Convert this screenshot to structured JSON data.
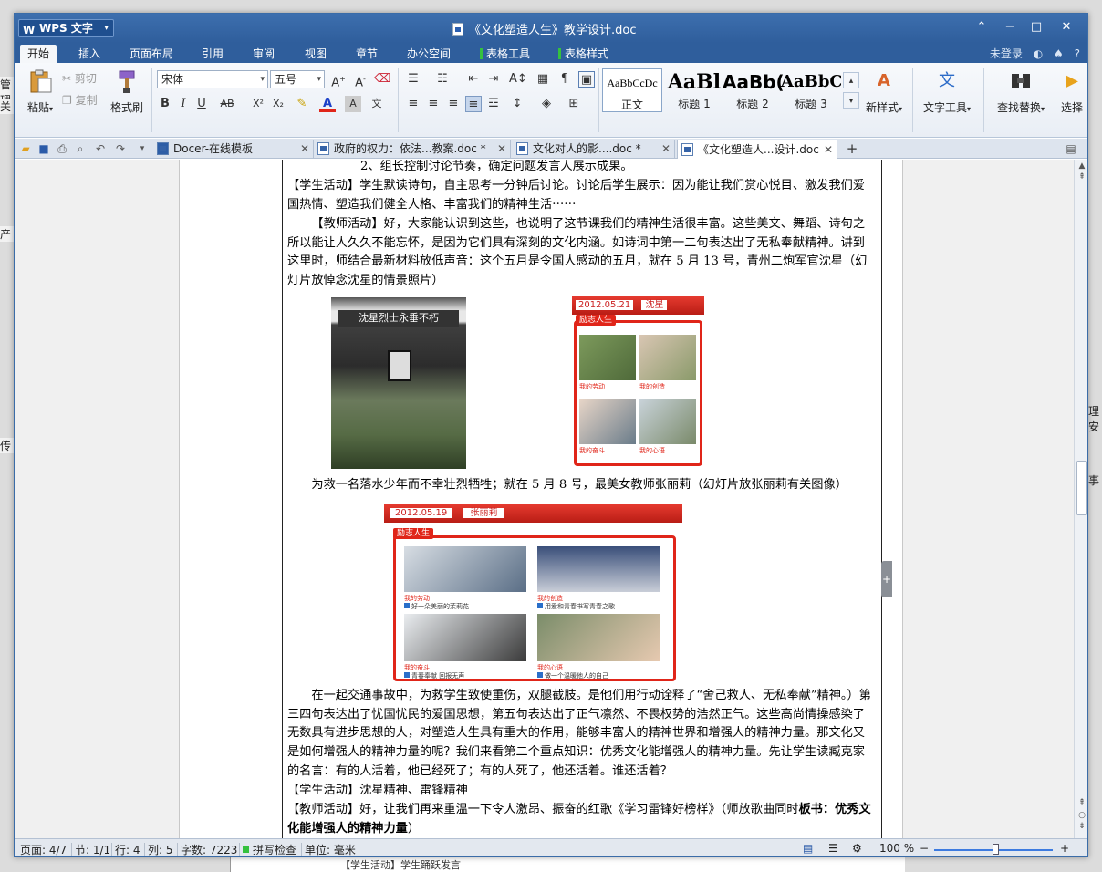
{
  "background": {
    "left_labels": [
      "管理",
      "关",
      "产",
      "传"
    ],
    "right_labels": [
      "理安",
      "事"
    ],
    "bottom_text": "【学生活动】学生踊跃发言"
  },
  "titlebar": {
    "app_name": "WPS 文字",
    "doc_title": "《文化塑造人生》教学设计.doc",
    "minimize": "−",
    "maximize": "□",
    "close": "✕",
    "collapse": "⌃"
  },
  "menu_tabs": [
    "开始",
    "插入",
    "页面布局",
    "引用",
    "审阅",
    "视图",
    "章节",
    "办公空间",
    "表格工具",
    "表格样式"
  ],
  "login": {
    "label": "未登录",
    "help": "?"
  },
  "ribbon": {
    "paste": "粘贴",
    "cut": "剪切",
    "copy": "复制",
    "format_painter": "格式刷",
    "font_name": "宋体",
    "font_size": "五号",
    "styles": [
      {
        "sample": "AaBbCcDc",
        "label": "正文"
      },
      {
        "sample": "AaBl",
        "label": "标题 1"
      },
      {
        "sample": "AaBb(",
        "label": "标题 2"
      },
      {
        "sample": "AaBbC",
        "label": "标题 3"
      }
    ],
    "new_style": "新样式",
    "text_tools": "文字工具",
    "find_replace": "查找替换",
    "select": "选择"
  },
  "doc_tabs": [
    {
      "title": "Docer-在线模板"
    },
    {
      "title": "政府的权力：依法...教案.doc *"
    },
    {
      "title": "文化对人的影....doc *"
    },
    {
      "title": "《文化塑造人...设计.doc"
    }
  ],
  "document": {
    "p1": "2、组长控制讨论节奏，确定问题发言人展示成果。",
    "p2": "【学生活动】学生默读诗句，自主思考一分钟后讨论。讨论后学生展示：因为能让我们赏心悦目、激发我们爱国热情、塑造我们健全人格、丰富我们的精神生活⋯⋯",
    "p3": "【教师活动】好，大家能认识到这些，也说明了这节课我们的精神生活很丰富。这些美文、舞蹈、诗句之所以能让人久久不能忘怀，是因为它们具有深刻的文化内涵。如诗词中第一二句表达出了无私奉献精神。讲到这里时，师结合最新材料放低声音：这个五月是令国人感动的五月，就在 5 月 13 号，青州二炮军官沈星（幻灯片放悼念沈星的情景照片）",
    "p4": "为救一名落水少年而不幸壮烈牺牲；就在 5 月 8 号，最美女教师张丽莉（幻灯片放张丽莉有关图像）",
    "p5": "在一起交通事故中，为救学生致使重伤，双腿截肢。是他们用行动诠释了“舍己救人、无私奉献”精神。）第三四句表达出了忧国忧民的爱国思想，第五句表达出了正气凛然、不畏权势的浩然正气。这些高尚情操感染了无数具有进步思想的人，对塑造人生具有重大的作用，能够丰富人的精神世界和增强人的精神力量。那文化又是如何增强人的精神力量的呢？我们来看第二个重点知识：优秀文化能增强人的精神力量。先让学生读臧克家的名言：有的人活着，他已经死了；有的人死了，他还活着。谁还活着？",
    "p6": "【学生活动】沈星精神、雷锋精神",
    "p7_normal": "【教师活动】好，让我们再来重温一下令人激昂、振奋的红歌《学习雷锋好榜样》（师放歌曲同时",
    "p7_bold_a": "板书：",
    "p7_bold_b": "优秀文化能增强人的精神力量",
    "p7_end": "）"
  },
  "images": {
    "img1_banner": "沈星烈士永垂不朽",
    "img2_date": "2012.05.21",
    "img2_name": "沈星",
    "img2_tag": "励志人生",
    "img2_caps": [
      "我的劳动",
      "我的创造",
      "我的奋斗",
      "我的心语"
    ],
    "img3_date": "2012.05.19",
    "img3_name": "张丽莉",
    "img3_tag": "励志人生",
    "img3_caps": [
      "我的劳动",
      "我的创造",
      "我的奋斗",
      "我的心语"
    ],
    "img3_subs": [
      "好一朵美丽的茉莉花",
      "用爱和青春书写青春之歌",
      "青春奉献 回报无声",
      "做一个温暖他人的自己"
    ]
  },
  "statusbar": {
    "page": "页面: 4/7",
    "section": "节: 1/1",
    "row": "行: 4",
    "col": "列: 5",
    "words": "字数: 7223",
    "spell": "拼写检查",
    "unit": "单位: 毫米",
    "zoom": "100 %"
  },
  "colors": {
    "title_blue": "#2f5e9c",
    "accent_red": "#e02519",
    "context_green": "#35c13e"
  }
}
